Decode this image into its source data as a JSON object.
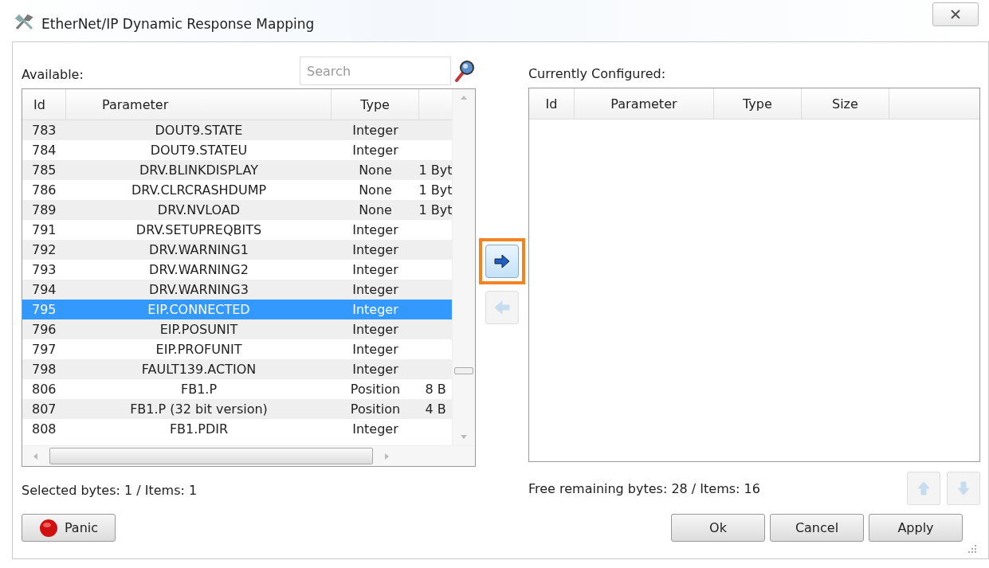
{
  "window": {
    "title": "EtherNet/IP Dynamic Response Mapping"
  },
  "available": {
    "label": "Available:",
    "search": {
      "placeholder": "Search"
    },
    "columns": [
      "Id",
      "Parameter",
      "Type"
    ],
    "rows": [
      {
        "id": "783",
        "parameter": "DOUT9.STATE",
        "type": "Integer",
        "column_4": "",
        "selected": false
      },
      {
        "id": "784",
        "parameter": "DOUT9.STATEU",
        "type": "Integer",
        "column_4": "",
        "selected": false
      },
      {
        "id": "785",
        "parameter": "DRV.BLINKDISPLAY",
        "type": "None",
        "column_4": "1 Byt",
        "selected": false
      },
      {
        "id": "786",
        "parameter": "DRV.CLRCRASHDUMP",
        "type": "None",
        "column_4": "1 Byt",
        "selected": false
      },
      {
        "id": "789",
        "parameter": "DRV.NVLOAD",
        "type": "None",
        "column_4": "1 Byt",
        "selected": false
      },
      {
        "id": "791",
        "parameter": "DRV.SETUPREQBITS",
        "type": "Integer",
        "column_4": "",
        "selected": false
      },
      {
        "id": "792",
        "parameter": "DRV.WARNING1",
        "type": "Integer",
        "column_4": "",
        "selected": false
      },
      {
        "id": "793",
        "parameter": "DRV.WARNING2",
        "type": "Integer",
        "column_4": "",
        "selected": false
      },
      {
        "id": "794",
        "parameter": "DRV.WARNING3",
        "type": "Integer",
        "column_4": "",
        "selected": false
      },
      {
        "id": "795",
        "parameter": "EIP.CONNECTED",
        "type": "Integer",
        "column_4": "",
        "selected": true
      },
      {
        "id": "796",
        "parameter": "EIP.POSUNIT",
        "type": "Integer",
        "column_4": "",
        "selected": false
      },
      {
        "id": "797",
        "parameter": "EIP.PROFUNIT",
        "type": "Integer",
        "column_4": "",
        "selected": false
      },
      {
        "id": "798",
        "parameter": "FAULT139.ACTION",
        "type": "Integer",
        "column_4": "",
        "selected": false
      },
      {
        "id": "806",
        "parameter": "FB1.P",
        "type": "Position",
        "column_4": "8 B",
        "selected": false
      },
      {
        "id": "807",
        "parameter": "FB1.P (32 bit version)",
        "type": "Position",
        "column_4": "4 B",
        "selected": false
      },
      {
        "id": "808",
        "parameter": "FB1.PDIR",
        "type": "Integer",
        "column_4": "",
        "selected": false
      }
    ],
    "status": "Selected bytes:  1 / Items: 1"
  },
  "transfer": {
    "add": {
      "disabled": false,
      "highlighted": true
    },
    "remove": {
      "disabled": true,
      "highlighted": false
    }
  },
  "configured": {
    "label": "Currently Configured:",
    "columns": [
      "Id",
      "Parameter",
      "Type",
      "Size"
    ],
    "status": "Free remaining bytes:  28 / Items: 16",
    "move_up": {
      "disabled": true
    },
    "move_down": {
      "disabled": true
    }
  },
  "buttons": {
    "panic": "Panic",
    "ok": "Ok",
    "cancel": "Cancel",
    "apply": "Apply"
  }
}
